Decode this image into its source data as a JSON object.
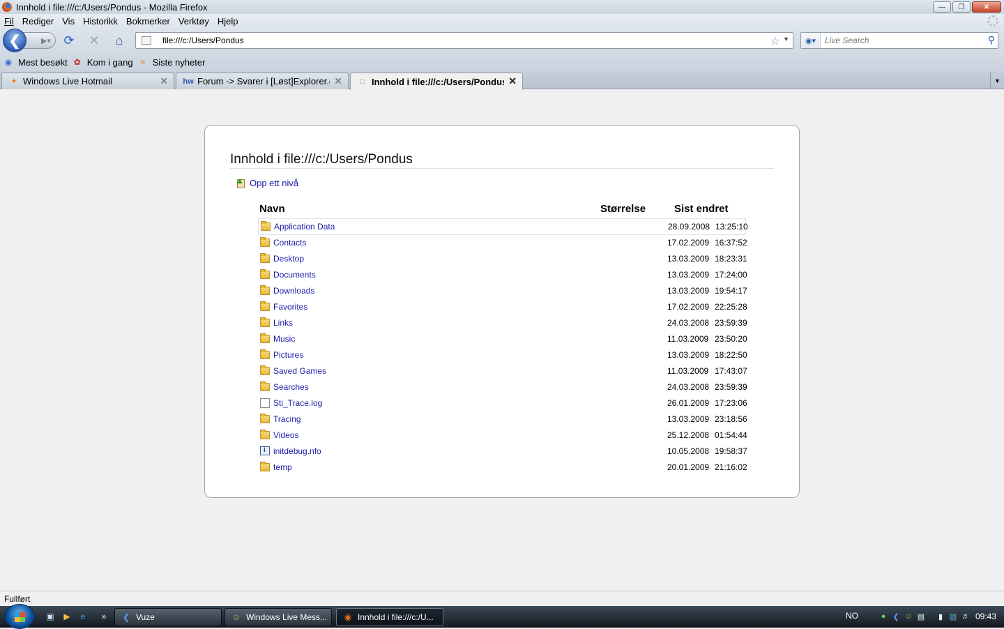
{
  "window": {
    "title": "Innhold i file:///c:/Users/Pondus - Mozilla Firefox"
  },
  "menu": [
    {
      "u": "F",
      "rest": "il"
    },
    {
      "u": "R",
      "rest": "ediger"
    },
    {
      "u": "V",
      "rest": "is"
    },
    {
      "u": "H",
      "rest": "istorikk",
      "pre": ""
    },
    {
      "u": "B",
      "rest": "okmerker"
    },
    {
      "u": "V",
      "rest": "erktøy",
      "pre": ""
    },
    {
      "u": "H",
      "rest": "jelp"
    }
  ],
  "menu_labels": [
    "Fil",
    "Rediger",
    "Vis",
    "Historikk",
    "Bokmerker",
    "Verktøy",
    "Hjelp"
  ],
  "nav": {
    "url": "file:///c:/Users/Pondus",
    "search_placeholder": "Live Search"
  },
  "bookmarks": [
    "Mest besøkt",
    "Kom i gang",
    "Siste nyheter"
  ],
  "tabs": [
    {
      "label": "Windows Live Hotmail",
      "active": false
    },
    {
      "label": "Forum -> Svarer i [Løst]Explorer.exe...",
      "active": false
    },
    {
      "label": "Innhold i file:///c:/Users/Pondus",
      "active": true
    }
  ],
  "listing": {
    "title": "Innhold i file:///c:/Users/Pondus",
    "up_link": "Opp ett nivå",
    "headers": {
      "name": "Navn",
      "size": "Størrelse",
      "modified": "Sist endret"
    },
    "rows": [
      {
        "name": "Application Data",
        "type": "folder",
        "date": "28.09.2008",
        "time": "13:25:10"
      },
      {
        "name": "Contacts",
        "type": "folder",
        "date": "17.02.2009",
        "time": "16:37:52"
      },
      {
        "name": "Desktop",
        "type": "folder",
        "date": "13.03.2009",
        "time": "18:23:31"
      },
      {
        "name": "Documents",
        "type": "folder",
        "date": "13.03.2009",
        "time": "17:24:00"
      },
      {
        "name": "Downloads",
        "type": "folder",
        "date": "13.03.2009",
        "time": "19:54:17"
      },
      {
        "name": "Favorites",
        "type": "folder",
        "date": "17.02.2009",
        "time": "22:25:28"
      },
      {
        "name": "Links",
        "type": "folder",
        "date": "24.03.2008",
        "time": "23:59:39"
      },
      {
        "name": "Music",
        "type": "folder",
        "date": "11.03.2009",
        "time": "23:50:20"
      },
      {
        "name": "Pictures",
        "type": "folder",
        "date": "13.03.2009",
        "time": "18:22:50"
      },
      {
        "name": "Saved Games",
        "type": "folder",
        "date": "11.03.2009",
        "time": "17:43:07"
      },
      {
        "name": "Searches",
        "type": "folder",
        "date": "24.03.2008",
        "time": "23:59:39"
      },
      {
        "name": "Sti_Trace.log",
        "type": "file",
        "date": "26.01.2009",
        "time": "17:23:06"
      },
      {
        "name": "Tracing",
        "type": "folder",
        "date": "13.03.2009",
        "time": "23:18:56"
      },
      {
        "name": "Videos",
        "type": "folder",
        "date": "25.12.2008",
        "time": "01:54:44"
      },
      {
        "name": "initdebug.nfo",
        "type": "nfo",
        "date": "10.05.2008",
        "time": "19:58:37"
      },
      {
        "name": "temp",
        "type": "folder",
        "date": "20.01.2009",
        "time": "21:16:02"
      }
    ]
  },
  "status": "Fullført",
  "taskbar": {
    "tasks": [
      {
        "label": "Vuze",
        "active": false
      },
      {
        "label": "Windows Live Mess...",
        "active": false
      },
      {
        "label": "Innhold i file:///c:/U...",
        "active": true
      }
    ],
    "lang": "NO",
    "clock": "09:43"
  }
}
